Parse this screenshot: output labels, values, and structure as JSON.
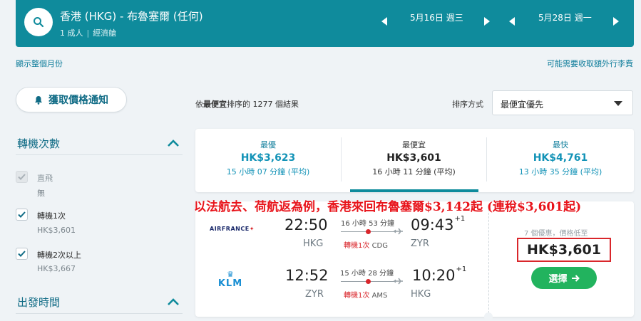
{
  "search": {
    "route": "香港 (HKG) - 布魯塞爾 (任何)",
    "passengers": "1 成人",
    "cabin": "經濟艙",
    "depart_date": "5月16日 週三",
    "return_date": "5月28日 週一"
  },
  "links": {
    "show_month": "顯示整個月份",
    "fees_note": "可能需要收取額外行李費"
  },
  "price_alert": {
    "label": "獲取價格通知"
  },
  "filters": {
    "stops_title": "轉機次數",
    "departure_title": "出發時間",
    "options": [
      {
        "label": "直飛",
        "sub": "無",
        "checked": true,
        "disabled": true
      },
      {
        "label": "轉機1次",
        "sub": "HK$3,601",
        "checked": true,
        "disabled": false
      },
      {
        "label": "轉機2次以上",
        "sub": "HK$3,667",
        "checked": true,
        "disabled": false
      }
    ]
  },
  "results": {
    "prefix": "依",
    "bold": "最便宜",
    "suffix": "排序的 1277 個結果",
    "sort_label": "排序方式",
    "sort_value": "最便宜優先"
  },
  "tabs": [
    {
      "name": "最優",
      "price": "HK$3,623",
      "duration": "15 小時 07 分鐘 (平均)",
      "active": false
    },
    {
      "name": "最便宜",
      "price": "HK$3,601",
      "duration": "16 小時 11 分鐘 (平均)",
      "active": true
    },
    {
      "name": "最快",
      "price": "HK$4,761",
      "duration": "13 小時 35 分鐘 (平均)",
      "active": false
    }
  ],
  "annotation": "以法航去、荷航返為例，香港來回布魯塞爾$3,142起 (連稅$3,601起)",
  "itinerary": {
    "outbound": {
      "airline": "AIRFRANCE",
      "depart_time": "22:50",
      "arrive_time": "09:43",
      "day_offset": "+1",
      "from": "HKG",
      "to": "ZYR",
      "duration": "16 小時 53 分鐘",
      "stops": "轉機1次",
      "via": "CDG"
    },
    "inbound": {
      "airline": "KLM",
      "depart_time": "12:52",
      "arrive_time": "10:20",
      "day_offset": "+1",
      "from": "ZYR",
      "to": "HKG",
      "duration": "15 小時 28 分鐘",
      "stops": "轉機1次",
      "via": "AMS"
    },
    "deals": "7 個優惠，價格低至",
    "price": "HK$3,601",
    "select": "選擇"
  },
  "colors": {
    "brand": "#0f8b9c",
    "accent": "#1393b7",
    "select_button": "#22b35e",
    "annotation": "#e8141b"
  },
  "icons": {
    "search": "search-icon",
    "bell": "bell-icon",
    "chevron_up": "chevron-up-icon",
    "prev": "triangle-left-icon",
    "next": "triangle-right-icon",
    "plane": "plane-icon",
    "arrow": "arrow-right-icon"
  }
}
